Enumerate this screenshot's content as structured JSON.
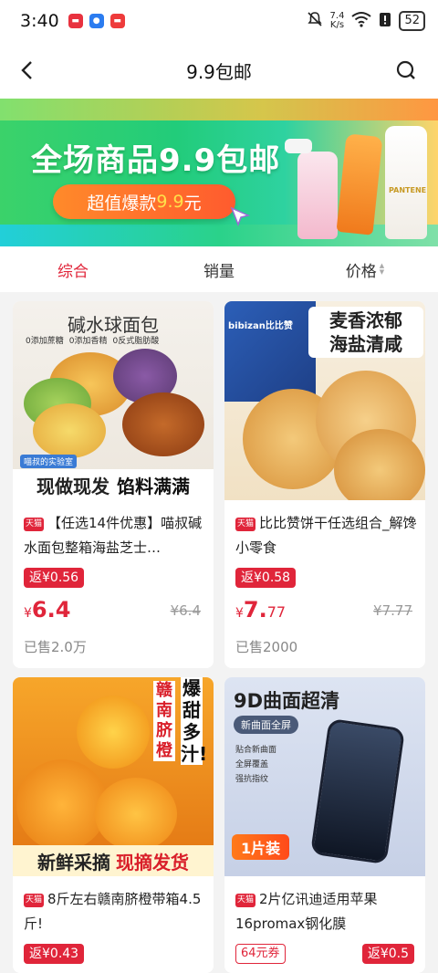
{
  "status_bar": {
    "time": "3:40",
    "net_speed_value": "7.4",
    "net_speed_unit": "K/s",
    "battery": "52",
    "icons": [
      "app-red-icon",
      "app-blue-icon",
      "app-red-icon",
      "mute-icon",
      "wifi-icon",
      "alert-icon",
      "battery-icon"
    ]
  },
  "header": {
    "title": "9.9包邮",
    "back_icon": "back-arrow-icon",
    "search_icon": "search-icon"
  },
  "banner": {
    "title": "全场商品9.9包邮",
    "pill_prefix": "超值爆款",
    "pill_price": "9.9",
    "pill_suffix": "元",
    "bottle_brand": "PANTENE"
  },
  "sort_tabs": [
    {
      "label": "综合",
      "active": true
    },
    {
      "label": "销量",
      "active": false
    },
    {
      "label": "价格",
      "active": false
    }
  ],
  "products": [
    {
      "image_text_top": "碱水球面包",
      "image_text_tags": [
        "0添加蔗糖",
        "0添加香精",
        "0反式脂肪酸"
      ],
      "image_text_ribbon": "喵叔的实验室",
      "image_text_bottom_a": "现做现发",
      "image_text_bottom_b": "馅料满满",
      "platform": "天猫",
      "name": "【任选14件优惠】喵叔碱水面包整箱海盐芝士…",
      "rebate": "返¥0.56",
      "price_symbol": "¥",
      "price": "6.4",
      "old_price": "¥6.4",
      "sold": "已售2.0万"
    },
    {
      "image_text_top_a": "麦香浓郁",
      "image_text_top_b": "海盐清咸",
      "image_text_brand": "bibizan比比赞",
      "platform": "天猫",
      "name": "比比赞饼干任选组合_解馋小零食",
      "rebate": "返¥0.58",
      "price_symbol": "¥",
      "price_int": "7.",
      "price_dec": "77",
      "old_price": "¥7.77",
      "sold": "已售2000"
    },
    {
      "image_text_side_a": "赣南脐橙",
      "image_text_side_b": "爆甜多汁!",
      "image_text_bottom_a": "新鲜采摘",
      "image_text_bottom_b": "现摘发货",
      "platform": "天猫",
      "name": "8斤左右赣南脐橙带箱4.5斤!",
      "rebate": "返¥0.43"
    },
    {
      "image_text_title": "9D曲面超清",
      "image_text_sub": "新曲面全屏",
      "image_text_features": [
        "贴合新曲面",
        "全屏覆盖",
        "强抗指纹"
      ],
      "image_text_badge": "1片装",
      "platform": "天猫",
      "name": "2片亿讯迪适用苹果16promax钢化膜",
      "coupon": "64元券",
      "rebate": "返¥0.5"
    }
  ],
  "colors": {
    "accent": "#e0253a",
    "banner_green": "#2ecc71",
    "banner_pill": "#ff6a2c"
  }
}
